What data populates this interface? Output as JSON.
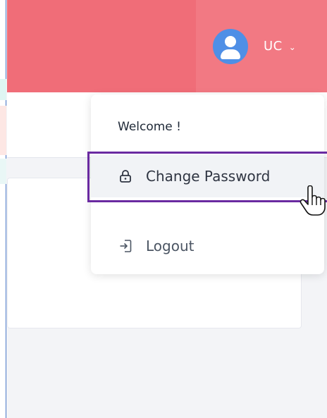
{
  "header": {
    "user_initials": "UC",
    "chevron": "⌄"
  },
  "user_menu": {
    "welcome_text": "Welcome !",
    "items": [
      {
        "label": "Change Password",
        "icon": "lock-icon"
      },
      {
        "label": "Logout",
        "icon": "logout-icon"
      }
    ]
  },
  "colors": {
    "header_bg": "#f06d78",
    "user_zone_bg": "#f27983",
    "avatar_bg": "#4f8fe6",
    "highlight_border": "#6a2aa1"
  }
}
